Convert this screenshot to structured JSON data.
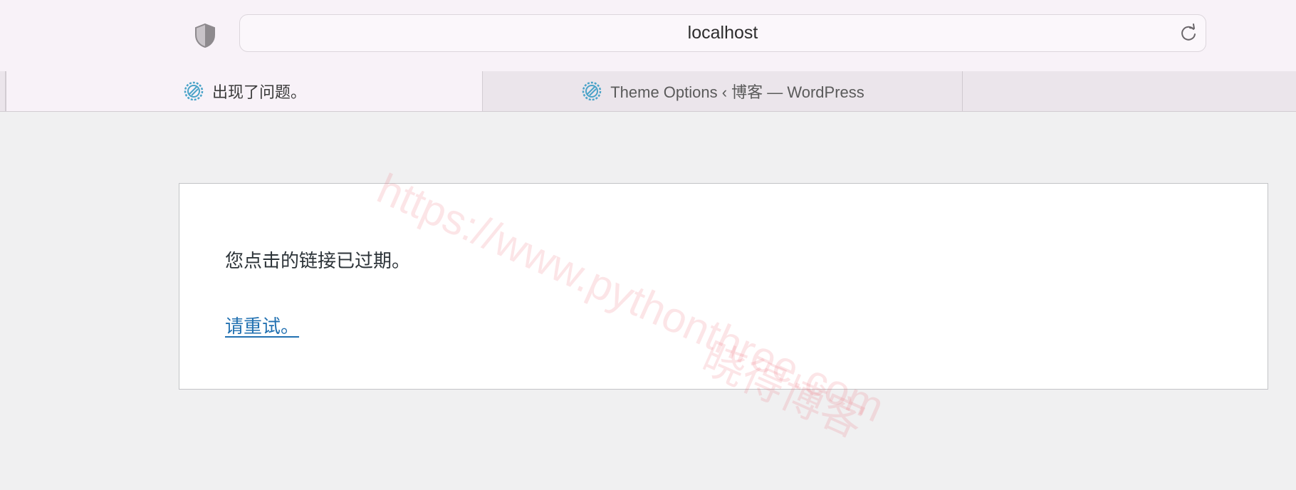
{
  "browser": {
    "url": "localhost",
    "icons": {
      "privacy": "shield-icon",
      "reload": "reload-icon",
      "favicon": "wordpress-gear-icon"
    },
    "tabs": [
      {
        "title": "出现了问题。",
        "active": true
      },
      {
        "title": "Theme Options ‹ 博客 — WordPress",
        "active": false
      }
    ]
  },
  "page": {
    "message": "您点击的链接已过期。",
    "retry_link": "请重试。"
  },
  "watermark": {
    "url": "https://www.pythonthree.com",
    "site_name": "晓得博客"
  },
  "colors": {
    "toolbar_bg": "#f8f2f8",
    "page_bg": "#f0f0f1",
    "link": "#2271b1",
    "favicon": "#4aa3c8",
    "watermark": "#f06e78"
  }
}
